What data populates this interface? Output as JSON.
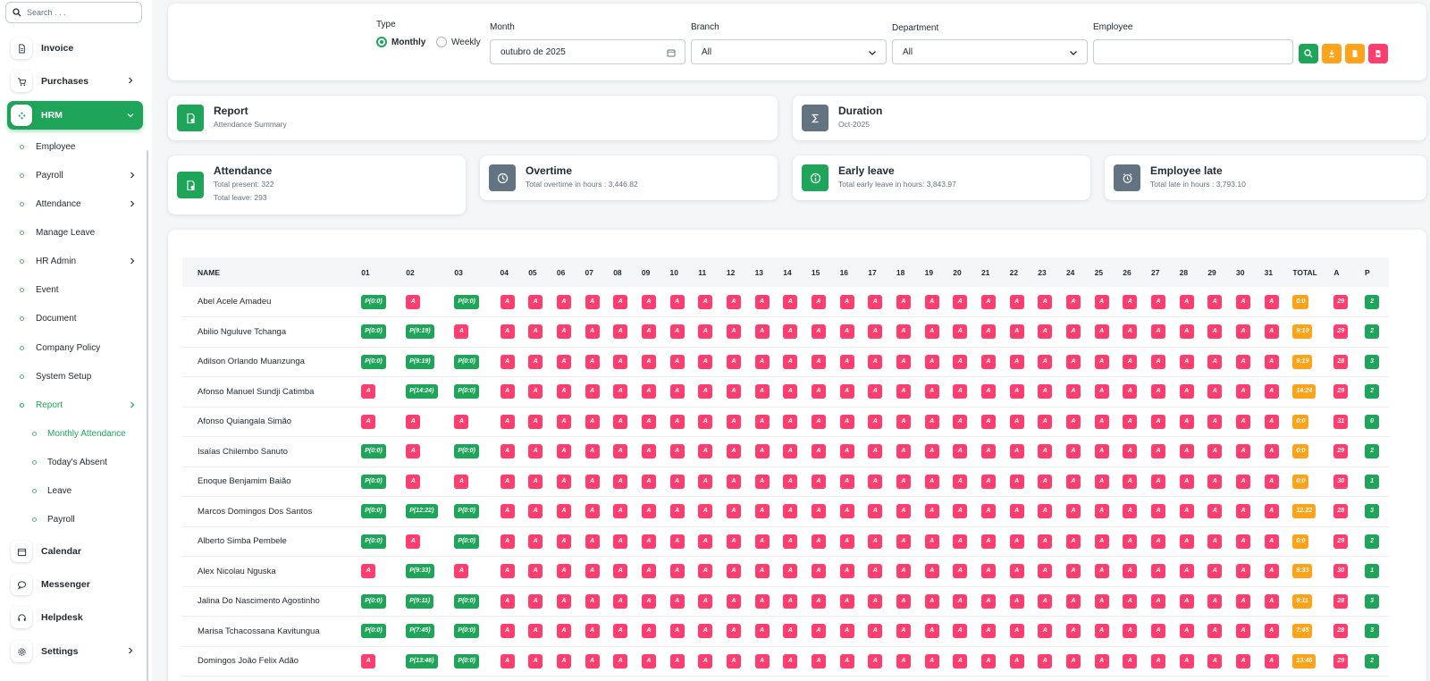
{
  "search": {
    "placeholder": "Search . . ."
  },
  "sidebar": {
    "invoice": "Invoice",
    "purchases": "Purchases",
    "hrm": "HRM",
    "hrm_sub": {
      "employee": "Employee",
      "payroll": "Payroll",
      "attendance": "Attendance",
      "manage_leave": "Manage Leave",
      "hr_admin": "HR Admin",
      "event": "Event",
      "document": "Document",
      "company_policy": "Company Policy",
      "system_setup": "System Setup",
      "report": "Report"
    },
    "report_sub": {
      "monthly_attendance": "Monthly Attendance",
      "todays_absent": "Today's Absent",
      "leave": "Leave",
      "payroll": "Payroll"
    },
    "calendar": "Calendar",
    "messenger": "Messenger",
    "helpdesk": "Helpdesk",
    "settings": "Settings"
  },
  "filters": {
    "type_label": "Type",
    "monthly": "Monthly",
    "weekly": "Weekly",
    "month_label": "Month",
    "month_value": "outubro de 2025",
    "branch_label": "Branch",
    "branch_value": "All",
    "department_label": "Department",
    "department_value": "All",
    "employee_label": "Employee",
    "employee_value": ""
  },
  "summary": {
    "report_title": "Report",
    "report_sub": "Attendance Summary",
    "duration_title": "Duration",
    "duration_sub": "Oct-2025",
    "attendance_title": "Attendance",
    "attendance_present": "Total present: 322",
    "attendance_leave": "Total leave: 293",
    "overtime_title": "Overtime",
    "overtime_sub": "Total overtime in hours : 3,446.82",
    "early_title": "Early leave",
    "early_sub": "Total early leave in hours: 3,843.97",
    "late_title": "Employee late",
    "late_sub": "Total late in hours : 3,793.10"
  },
  "table": {
    "headers": [
      "NAME",
      "01",
      "02",
      "03",
      "04",
      "05",
      "06",
      "07",
      "08",
      "09",
      "10",
      "11",
      "12",
      "13",
      "14",
      "15",
      "16",
      "17",
      "18",
      "19",
      "20",
      "21",
      "22",
      "23",
      "24",
      "25",
      "26",
      "27",
      "28",
      "29",
      "30",
      "31",
      "TOTAL",
      "A",
      "P"
    ],
    "rows": [
      {
        "name": "Abel Acele Amadeu",
        "d1": "P(0:0)",
        "d2": "A",
        "d3": "P(0:0)",
        "total": "0:0",
        "a": "29",
        "p": "2"
      },
      {
        "name": "Abilio Nguluve Tchanga",
        "d1": "P(0:0)",
        "d2": "P(9:19)",
        "d3": "A",
        "total": "9:19",
        "a": "29",
        "p": "2"
      },
      {
        "name": "Adilson Orlando Muanzunga",
        "d1": "P(0:0)",
        "d2": "P(9:19)",
        "d3": "P(0:0)",
        "total": "9:19",
        "a": "28",
        "p": "3"
      },
      {
        "name": "Afonso Manuel Sundji Catimba",
        "d1": "A",
        "d2": "P(14:24)",
        "d3": "P(0:0)",
        "total": "14:24",
        "a": "29",
        "p": "2"
      },
      {
        "name": "Afonso Quiangala Simão",
        "d1": "A",
        "d2": "A",
        "d3": "A",
        "total": "0:0",
        "a": "31",
        "p": "0"
      },
      {
        "name": "Isaías Chilembo Sanuto",
        "d1": "P(0:0)",
        "d2": "A",
        "d3": "P(0:0)",
        "total": "0:0",
        "a": "29",
        "p": "2"
      },
      {
        "name": "Enoque Benjamim Baião",
        "d1": "P(0:0)",
        "d2": "A",
        "d3": "A",
        "total": "0:0",
        "a": "30",
        "p": "1"
      },
      {
        "name": "Marcos Domingos Dos Santos",
        "d1": "P(0:0)",
        "d2": "P(12:22)",
        "d3": "P(0:0)",
        "total": "12:22",
        "a": "28",
        "p": "3"
      },
      {
        "name": "Alberto Simba Pembele",
        "d1": "P(0:0)",
        "d2": "A",
        "d3": "P(0:0)",
        "total": "0:0",
        "a": "29",
        "p": "2"
      },
      {
        "name": "Alex Nicolau Nguska",
        "d1": "A",
        "d2": "P(9:33)",
        "d3": "A",
        "total": "9:33",
        "a": "30",
        "p": "1"
      },
      {
        "name": "Jalina Do Nascimento Agostinho",
        "d1": "P(0:0)",
        "d2": "P(9:11)",
        "d3": "P(0:0)",
        "total": "9:11",
        "a": "28",
        "p": "3"
      },
      {
        "name": "Marisa Tchacossana Kavitungua",
        "d1": "P(0:0)",
        "d2": "P(7:45)",
        "d3": "P(0:0)",
        "total": "7:45",
        "a": "28",
        "p": "3"
      },
      {
        "name": "Domingos João Felix Adão",
        "d1": "A",
        "d2": "P(13:46)",
        "d3": "P(0:0)",
        "total": "13:46",
        "a": "29",
        "p": "2"
      }
    ],
    "absent_mark": "A"
  },
  "colors": {
    "accent": "#1fa55a",
    "absent": "#ff3d6e",
    "total": "#ffa31a",
    "muted_icon": "#637381"
  }
}
